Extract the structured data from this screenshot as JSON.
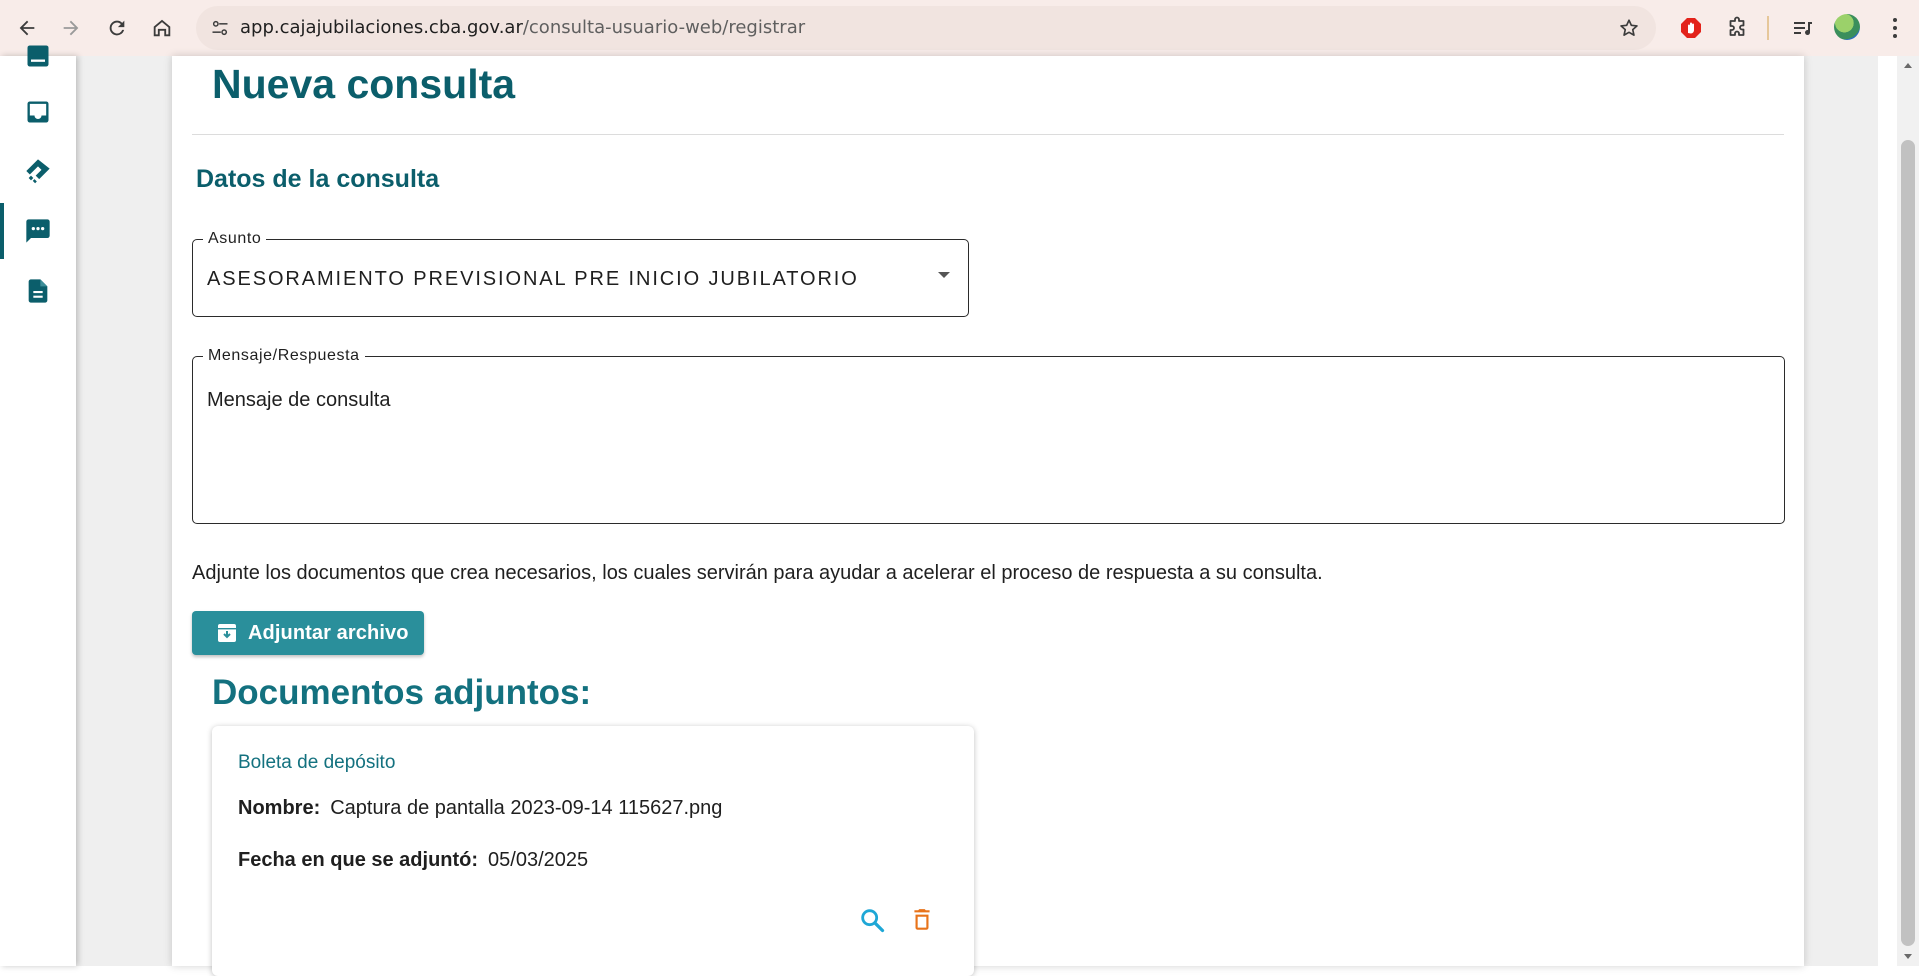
{
  "browser": {
    "url_host": "app.cajajubilaciones.cba.gov.ar",
    "url_path": "/consulta-usuario-web/registrar",
    "icons": [
      "back-arrow-icon",
      "forward-arrow-icon",
      "reload-icon",
      "home-icon",
      "site-info-icon",
      "bookmark-star-icon",
      "adblock-extension-icon",
      "extensions-puzzle-icon",
      "media-queue-icon",
      "profile-avatar",
      "kebab-menu-icon"
    ]
  },
  "sidebar": {
    "items": [
      {
        "icon": "list-icon",
        "active": false
      },
      {
        "icon": "inbox-icon",
        "active": false
      },
      {
        "icon": "handshake-icon",
        "active": false
      },
      {
        "icon": "chat-bubble-icon",
        "active": true
      },
      {
        "icon": "document-icon",
        "active": false
      }
    ],
    "accent": "#0b5e6b"
  },
  "page": {
    "title": "Nueva consulta",
    "section_title": "Datos de la consulta",
    "asunto": {
      "label": "Asunto",
      "value": "ASESORAMIENTO PREVISIONAL PRE INICIO JUBILATORIO"
    },
    "mensaje": {
      "label": "Mensaje/Respuesta",
      "value": "Mensaje de consulta"
    },
    "help_text": "Adjunte los documentos que crea necesarios, los cuales servirán para ayudar a acelerar el proceso de respuesta a su consulta.",
    "attach_button": "Adjuntar archivo",
    "docs_title": "Documentos adjuntos:",
    "document": {
      "type": "Boleta de depósito",
      "name_label": "Nombre:",
      "name_value": "Captura de pantalla 2023-09-14 115627.png",
      "date_label": "Fecha en que se adjuntó:",
      "date_value": "05/03/2025"
    }
  },
  "colors": {
    "brand_teal": "#0b5e6b",
    "button_teal": "#2a8f9b",
    "view_icon": "#1ea7d6",
    "delete_icon": "#e8731a"
  }
}
